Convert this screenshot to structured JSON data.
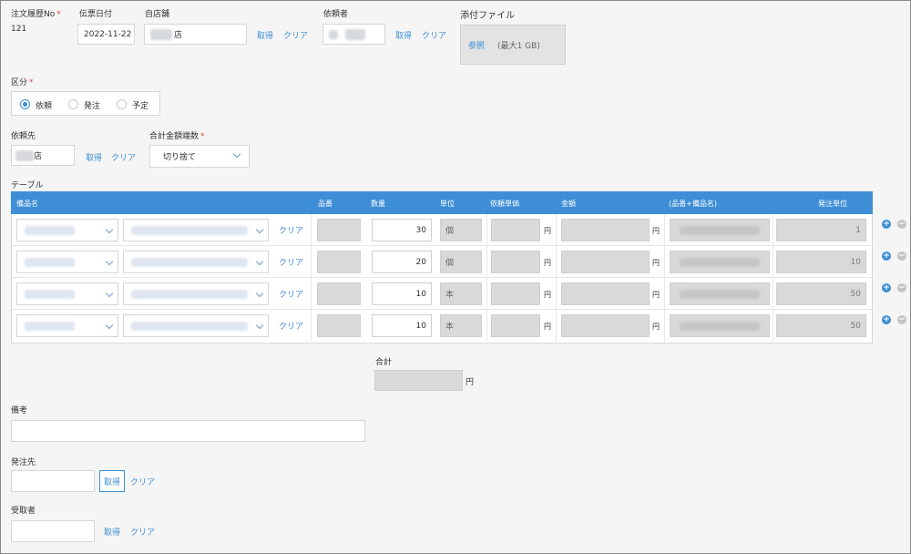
{
  "header": {
    "order_no_label": "注文履歴No",
    "order_no_value": "121",
    "date_label": "伝票日付",
    "date_value": "2022-11-22",
    "store_label": "自店舗",
    "store_value_suffix": "店",
    "requester_label": "依頼者",
    "attach_label": "添付ファイル",
    "browse_label": "参照",
    "max_size": "(最大1 GB)",
    "fetch_label": "取得",
    "clear_label": "クリア"
  },
  "category": {
    "label": "区分",
    "options": [
      "依頼",
      "発注",
      "予定"
    ],
    "selected": "依頼"
  },
  "request_to": {
    "label": "依頼先",
    "value_suffix": "店"
  },
  "rounding": {
    "label": "合計金額端数",
    "selected": "切り捨て"
  },
  "table": {
    "title": "テーブル",
    "columns": [
      "備品名",
      "品番",
      "数量",
      "単位",
      "依頼単価",
      "金額",
      "(品番+備品名)",
      "発注単位"
    ],
    "currency": "円",
    "clear_label": "クリア",
    "rows": [
      {
        "qty": "30",
        "unit": "個",
        "order_unit": "1"
      },
      {
        "qty": "20",
        "unit": "個",
        "order_unit": "10"
      },
      {
        "qty": "10",
        "unit": "本",
        "order_unit": "50"
      },
      {
        "qty": "10",
        "unit": "本",
        "order_unit": "50"
      }
    ]
  },
  "total": {
    "label": "合計",
    "currency": "円"
  },
  "remarks": {
    "label": "備考"
  },
  "order_to": {
    "label": "発注先"
  },
  "receiver": {
    "label": "受取者"
  },
  "colors": {
    "accent": "#3d8ed6",
    "required": "#e24b3c",
    "table_header": "#3d8ed6"
  }
}
